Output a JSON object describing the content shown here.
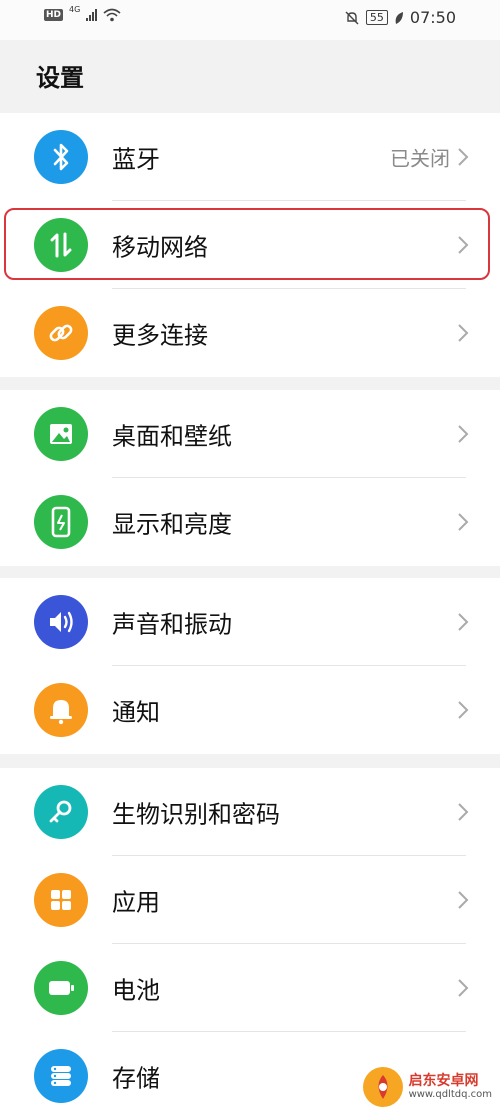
{
  "status_bar": {
    "hd": "HD",
    "network_type": "4G",
    "battery_level": "55",
    "time": "07:50"
  },
  "page_title": "设置",
  "groups": [
    {
      "items": [
        {
          "label": "蓝牙",
          "value": "已关闭",
          "icon": "bluetooth-icon",
          "color": "#1e9be8"
        },
        {
          "label": "移动网络",
          "icon": "mobile-data-icon",
          "color": "#2fb84c"
        },
        {
          "label": "更多连接",
          "icon": "link-icon",
          "color": "#f79a1d"
        }
      ]
    },
    {
      "items": [
        {
          "label": "桌面和壁纸",
          "icon": "wallpaper-icon",
          "color": "#2fb84c"
        },
        {
          "label": "显示和亮度",
          "icon": "display-icon",
          "color": "#2fb84c"
        }
      ]
    },
    {
      "items": [
        {
          "label": "声音和振动",
          "icon": "speaker-icon",
          "color": "#3b55d9"
        },
        {
          "label": "通知",
          "icon": "bell-icon",
          "color": "#f79a1d"
        }
      ]
    },
    {
      "items": [
        {
          "label": "生物识别和密码",
          "icon": "key-icon",
          "color": "#15b8b4"
        },
        {
          "label": "应用",
          "icon": "apps-icon",
          "color": "#f79a1d"
        },
        {
          "label": "电池",
          "icon": "battery-icon",
          "color": "#2fb84c"
        },
        {
          "label": "存储",
          "icon": "storage-icon",
          "color": "#1e9be8"
        }
      ]
    }
  ],
  "watermark": {
    "name": "启东安卓网",
    "url": "www.qdltdq.com"
  }
}
